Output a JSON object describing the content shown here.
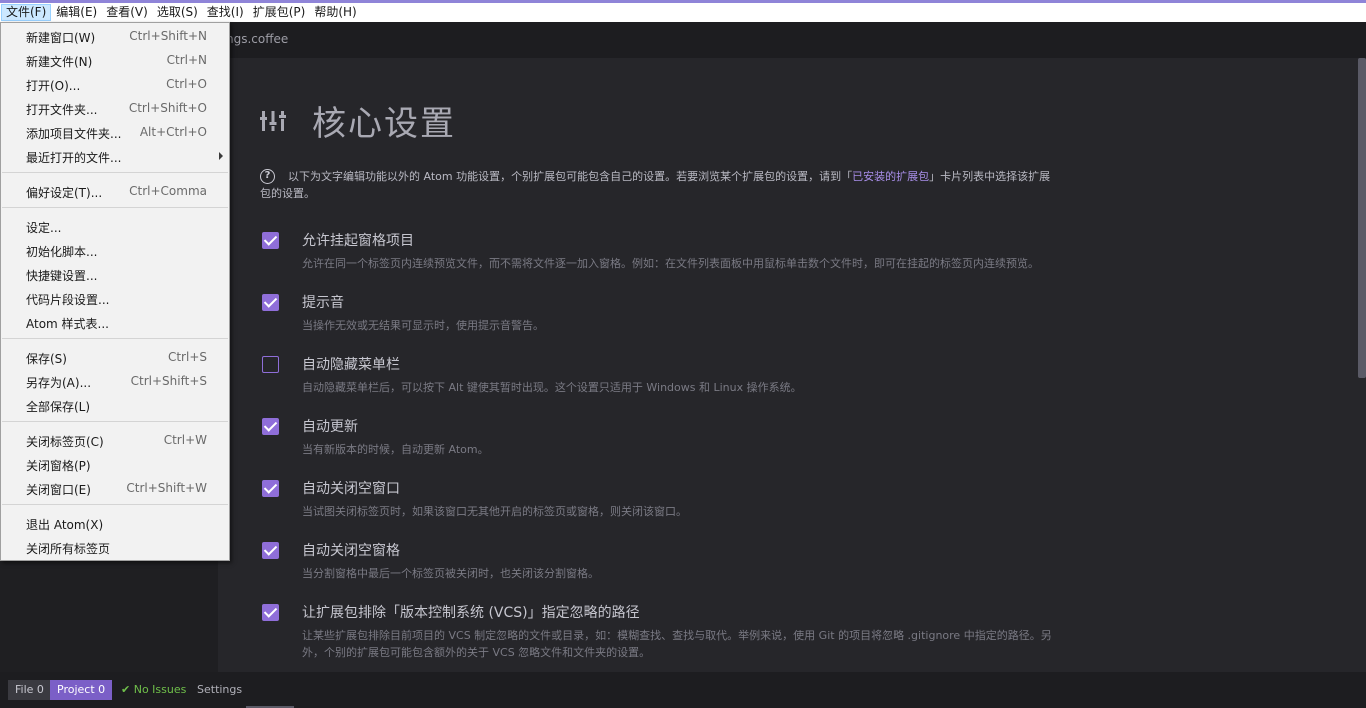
{
  "menubar": {
    "items": [
      {
        "label": "文件(F)",
        "active": true
      },
      {
        "label": "编辑(E)"
      },
      {
        "label": "查看(V)"
      },
      {
        "label": "选取(S)"
      },
      {
        "label": "查找(I)"
      },
      {
        "label": "扩展包(P)"
      },
      {
        "label": "帮助(H)"
      }
    ]
  },
  "tab": {
    "label": "ngs.coffee"
  },
  "file_menu": {
    "groups": [
      [
        {
          "label": "新建窗口(W)",
          "shortcut": "Ctrl+Shift+N"
        },
        {
          "label": "新建文件(N)",
          "shortcut": "Ctrl+N"
        },
        {
          "label": "打开(O)...",
          "shortcut": "Ctrl+O"
        },
        {
          "label": "打开文件夹...",
          "shortcut": "Ctrl+Shift+O"
        },
        {
          "label": "添加项目文件夹...",
          "shortcut": "Alt+Ctrl+O"
        },
        {
          "label": "最近打开的文件...",
          "shortcut": "",
          "submenu": true
        }
      ],
      [
        {
          "label": "偏好设定(T)...",
          "shortcut": "Ctrl+Comma"
        }
      ],
      [
        {
          "label": "设定...",
          "shortcut": ""
        },
        {
          "label": "初始化脚本...",
          "shortcut": ""
        },
        {
          "label": "快捷键设置...",
          "shortcut": ""
        },
        {
          "label": "代码片段设置...",
          "shortcut": ""
        },
        {
          "label": "Atom 样式表...",
          "shortcut": ""
        }
      ],
      [
        {
          "label": "保存(S)",
          "shortcut": "Ctrl+S"
        },
        {
          "label": "另存为(A)...",
          "shortcut": "Ctrl+Shift+S"
        },
        {
          "label": "全部保存(L)",
          "shortcut": ""
        }
      ],
      [
        {
          "label": "关闭标签页(C)",
          "shortcut": "Ctrl+W"
        },
        {
          "label": "关闭窗格(P)",
          "shortcut": ""
        },
        {
          "label": "关闭窗口(E)",
          "shortcut": "Ctrl+Shift+W"
        }
      ],
      [
        {
          "label": "退出 Atom(X)",
          "shortcut": ""
        },
        {
          "label": "关闭所有标签页",
          "shortcut": ""
        }
      ]
    ]
  },
  "settings": {
    "title": "核心设置",
    "intro_before": "以下为文字编辑功能以外的 Atom 功能设置，个别扩展包可能包含自己的设置。若要浏览某个扩展包的设置，请到「",
    "intro_link": "已安装的扩展包",
    "intro_after": "」卡片列表中选择该扩展包的设置。",
    "items": [
      {
        "title": "允许挂起窗格项目",
        "desc": "允许在同一个标签页内连续预览文件，而不需将文件逐一加入窗格。例如：在文件列表面板中用鼠标单击数个文件时，即可在挂起的标签页内连续预览。",
        "checked": true
      },
      {
        "title": "提示音",
        "desc": "当操作无效或无结果可显示时，使用提示音警告。",
        "checked": true
      },
      {
        "title": "自动隐藏菜单栏",
        "desc": "自动隐藏菜单栏后，可以按下 Alt 键使其暂时出现。这个设置只适用于 Windows 和 Linux 操作系统。",
        "checked": false
      },
      {
        "title": "自动更新",
        "desc": "当有新版本的时候，自动更新 Atom。",
        "checked": true
      },
      {
        "title": "自动关闭空窗口",
        "desc": "当试图关闭标签页时，如果该窗口无其他开启的标签页或窗格，则关闭该窗口。",
        "checked": true
      },
      {
        "title": "自动关闭空窗格",
        "desc": "当分割窗格中最后一个标签页被关闭时，也关闭该分割窗格。",
        "checked": true
      },
      {
        "title": "让扩展包排除「版本控制系统 (VCS)」指定忽略的路径",
        "desc": "让某些扩展包排除目前项目的 VCS 制定忽略的文件或目录，如：模糊查找、查找与取代。举例来说，使用 Git 的项目将忽略 .gitignore 中指定的路径。另外，个别的扩展包可能包含额外的关于 VCS 忽略文件和文件夹的设置。",
        "checked": true
      }
    ]
  },
  "statusbar": {
    "file": "File 0",
    "project": "Project 0",
    "issues": "No Issues",
    "settings": "Settings"
  },
  "colors": {
    "accent": "#8f6ed9",
    "project_badge": "#7b5fc7",
    "issues_green": "#6fbf4a",
    "link": "#a88ee8"
  },
  "icons": {
    "title": "sliders-icon",
    "intro": "question-circle-icon",
    "checkbox": "check-icon",
    "issues": "check-icon",
    "submenu": "chevron-right-icon"
  }
}
